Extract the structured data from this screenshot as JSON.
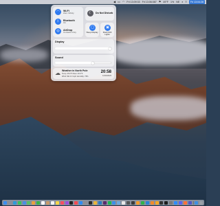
{
  "menubar": {
    "items": [
      {
        "kind": "icon",
        "icon": "volume-icon",
        "glyph": "◀"
      },
      {
        "kind": "icon",
        "icon": "battery-icon",
        "glyph": "▭"
      },
      {
        "kind": "icon",
        "icon": "wifi-icon",
        "glyph": "◠"
      },
      {
        "kind": "text",
        "text": "Fri 13:09:33",
        "sel": false
      },
      {
        "kind": "text",
        "text": "Fri 13:06:087",
        "sel": false
      },
      {
        "kind": "icon",
        "icon": "flag-icon",
        "glyph": "⚑"
      },
      {
        "kind": "text",
        "text": "49°F",
        "sel": false
      },
      {
        "kind": "text",
        "text": "1%",
        "sel": false
      },
      {
        "kind": "text",
        "text": "NE",
        "sel": false
      },
      {
        "kind": "icon",
        "icon": "search-icon",
        "glyph": "⌕"
      },
      {
        "kind": "icon",
        "icon": "control-center-icon",
        "glyph": "≡"
      },
      {
        "kind": "text",
        "text": "Fri 13:04:28",
        "sel": true
      }
    ]
  },
  "control_center": {
    "wifi": {
      "label": "Wi-Fi",
      "sub": "Zero Infinity",
      "icon": "wifi-icon",
      "glyph": "◠"
    },
    "bluetooth": {
      "label": "Bluetooth",
      "sub": "On",
      "icon": "bluetooth-icon",
      "glyph": "ᛒ"
    },
    "airdrop": {
      "label": "AirDrop",
      "sub": "Contacts Only",
      "icon": "airdrop-icon",
      "glyph": "◎"
    },
    "dnd": {
      "label": "Do Not Disturb",
      "sub": "",
      "icon": "moon-icon",
      "glyph": "☾"
    },
    "sleep": {
      "label": "Sleep Display",
      "icon": "display-sleep-icon",
      "glyph": "▢"
    },
    "flashlight": {
      "label": "Flash Drill Lights",
      "icon": "lights-icon",
      "glyph": "▣"
    },
    "display": {
      "label": "Display",
      "level": 0.98
    },
    "sound": {
      "label": "Sound",
      "level": 0.67
    },
    "weather": {
      "title": "Weather in North Pole",
      "line1": "Temp: 45.0°F  Dew: 40.0°F",
      "line2": "Wind: NE 3.0 mph  Humidity: 76%",
      "time": "20:58",
      "date": "12/23/2023",
      "icon": "weather-cloud-icon",
      "glyph": "☁"
    }
  },
  "dock": {
    "apps": [
      {
        "name": "finder",
        "color": "#3a8ef0"
      },
      {
        "name": "launchpad",
        "color": "#8b8f99"
      },
      {
        "name": "safari",
        "color": "#2e9bd8"
      },
      {
        "name": "messages",
        "color": "#3cc45b"
      },
      {
        "name": "mail",
        "color": "#4a90e2"
      },
      {
        "name": "maps",
        "color": "#5bbd6a"
      },
      {
        "name": "photos",
        "color": "#e9a03d"
      },
      {
        "name": "facetime",
        "color": "#39b54a"
      },
      {
        "name": "calendar",
        "color": "#ffffff"
      },
      {
        "name": "contacts",
        "color": "#c89a6a"
      },
      {
        "name": "reminders",
        "color": "#f4f4f4"
      },
      {
        "name": "notes",
        "color": "#f5d547"
      },
      {
        "name": "music",
        "color": "#fa4d60"
      },
      {
        "name": "podcasts",
        "color": "#9b4fd9"
      },
      {
        "name": "tv",
        "color": "#222222"
      },
      {
        "name": "news",
        "color": "#f34b53"
      },
      {
        "name": "app-store",
        "color": "#2f8bf5"
      },
      {
        "name": "system-preferences",
        "color": "#8c8c94"
      },
      {
        "name": "terminal",
        "color": "#2b2b2b"
      },
      {
        "name": "chrome",
        "color": "#e9b53a"
      },
      {
        "name": "vscode",
        "color": "#2a7cc4"
      },
      {
        "name": "slack",
        "color": "#5a2c6d"
      },
      {
        "name": "spotify",
        "color": "#1db954"
      },
      {
        "name": "xcode",
        "color": "#3b8fe8"
      },
      {
        "name": "preview",
        "color": "#6fa8dc"
      },
      {
        "name": "textedit",
        "color": "#e8e8e8"
      },
      {
        "name": "calculator",
        "color": "#555555"
      },
      {
        "name": "activity-monitor",
        "color": "#3c3c3c"
      },
      {
        "name": "pages",
        "color": "#f39c2c"
      },
      {
        "name": "numbers",
        "color": "#2fb34a"
      },
      {
        "name": "keynote",
        "color": "#2a83d5"
      },
      {
        "name": "books",
        "color": "#f08a2c"
      },
      {
        "name": "home",
        "color": "#f4a623"
      },
      {
        "name": "voice-memos",
        "color": "#333333"
      },
      {
        "name": "stocks",
        "color": "#1d1d1d"
      },
      {
        "name": "screenshot",
        "color": "#7a7a7a"
      },
      {
        "name": "zoom",
        "color": "#2d8cff"
      },
      {
        "name": "discord",
        "color": "#5865f2"
      },
      {
        "name": "firefox",
        "color": "#ff7139"
      },
      {
        "name": "teams",
        "color": "#5059c9"
      },
      {
        "name": "downloads",
        "color": "#3f8fe0"
      },
      {
        "name": "trash",
        "color": "#9aa0a8"
      }
    ]
  }
}
